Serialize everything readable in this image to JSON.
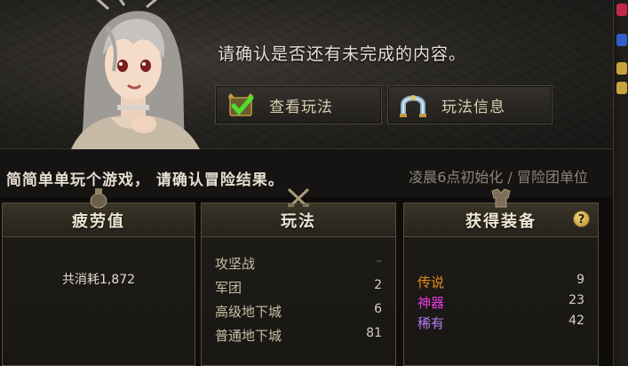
{
  "header": {
    "message": "请确认是否还有未完成的内容。",
    "buttons": {
      "view_label": "查看玩法",
      "info_label": "玩法信息"
    }
  },
  "subheader": {
    "left_text": "简简单单玩个游戏， 请确认冒险结果。",
    "right_text": "凌晨6点初始化 / 冒险团单位"
  },
  "panels": {
    "fatigue": {
      "title": "疲劳值",
      "total_text": "共消耗1,872"
    },
    "modes": {
      "title": "玩法",
      "rows": [
        {
          "label": "攻坚战",
          "value": "–"
        },
        {
          "label": "军团",
          "value": "2"
        },
        {
          "label": "高级地下城",
          "value": "6"
        },
        {
          "label": "普通地下城",
          "value": "81"
        }
      ]
    },
    "equipment": {
      "title": "获得装备",
      "help_label": "?",
      "rows": [
        {
          "label": "传说",
          "value": "9",
          "color": "#e88a1a"
        },
        {
          "label": "神器",
          "value": "23",
          "color": "#e23ad8"
        },
        {
          "label": "稀有",
          "value": "42",
          "color": "#b07cf0"
        }
      ]
    }
  },
  "icons": {
    "view_button_icon": "check-icon",
    "info_button_icon": "horseshoe-icon"
  }
}
